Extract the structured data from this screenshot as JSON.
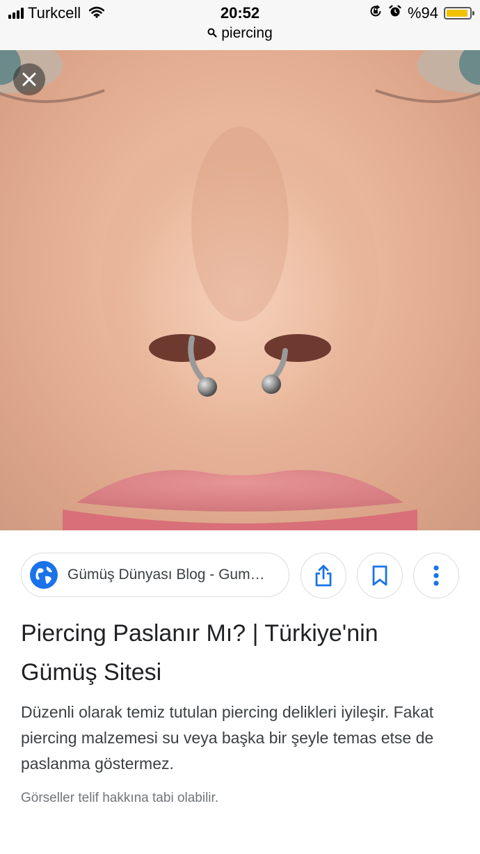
{
  "status_bar": {
    "carrier": "Turkcell",
    "time": "20:52",
    "url_query": "piercing",
    "battery_percent_text": "%94",
    "battery_level": 0.94,
    "battery_color": "#f2c200",
    "icons": [
      "signal-icon",
      "wifi-icon",
      "orientation-lock-icon",
      "alarm-icon",
      "battery-icon"
    ]
  },
  "viewer": {
    "close_icon": "close-icon",
    "image_subject": "septum-piercing-photo"
  },
  "result": {
    "source_label": "Gümüş Dünyası Blog - Gum…",
    "source_icon": "globe-icon",
    "action_icons": [
      "share-icon",
      "bookmark-icon",
      "more-vert-icon"
    ],
    "title": "Piercing Paslanır Mı? | Türkiye'nin Gümüş Sitesi",
    "description": "Düzenli olarak temiz tutulan piercing delikleri iyileşir. Fakat piercing malzemesi su veya başka bir şeyle temas etse de paslanma göstermez.",
    "copyright_note": "Görseller telif hakkına tabi olabilir."
  },
  "colors": {
    "accent_blue": "#1a73e8",
    "title_text": "#202124",
    "body_text": "#3c4043",
    "muted_text": "#70757a"
  }
}
